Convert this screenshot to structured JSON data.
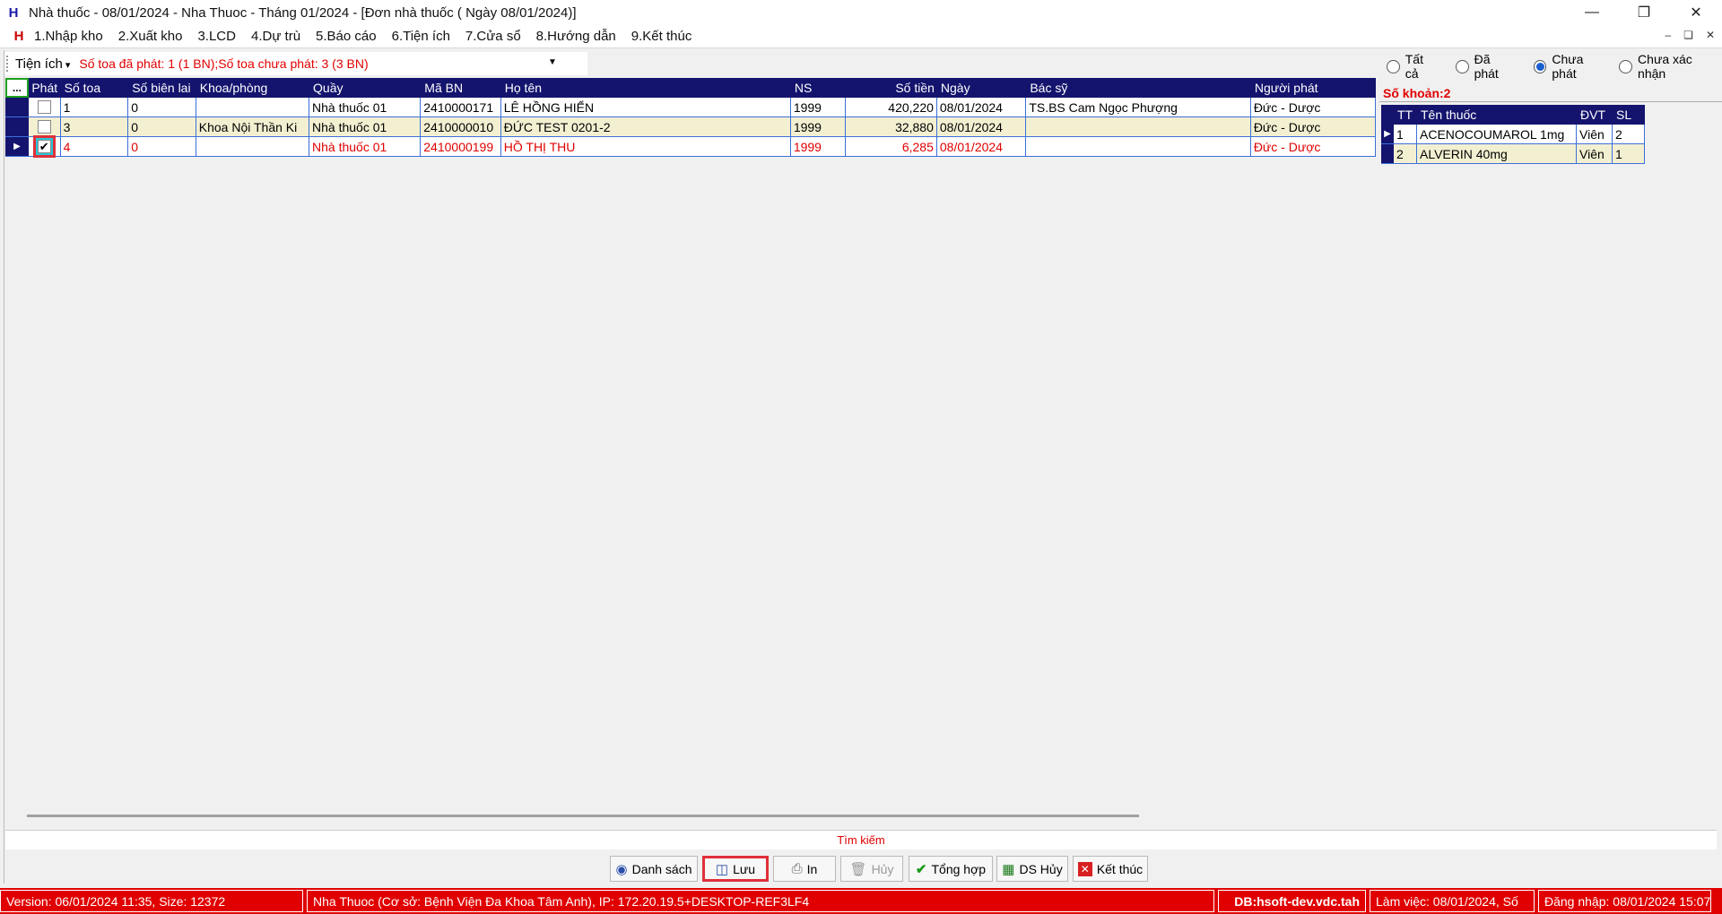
{
  "window": {
    "title": "Nhà thuốc - 08/01/2024 - Nha Thuoc - Tháng 01/2024 - [Đơn nhà thuốc ( Ngày 08/01/2024)]",
    "app_icon": "H",
    "controls": [
      "minimize-icon",
      "restore-icon",
      "close-icon"
    ]
  },
  "menu": {
    "logo": "H",
    "items": [
      "1.Nhập kho",
      "2.Xuất kho",
      "3.LCD",
      "4.Dự trù",
      "5.Báo cáo",
      "6.Tiện ích",
      "7.Cửa sổ",
      "8.Hướng dẫn",
      "9.Kết thúc"
    ]
  },
  "toolbar": {
    "tien_ich_label": "Tiện ích",
    "status_text": "Số toa đã phát: 1 (1 BN);Số toa chưa phát: 3 (3 BN)"
  },
  "grid": {
    "corner_label": "...",
    "columns": [
      "Phát",
      "Số toa",
      "Số biên lai",
      "Khoa/phòng",
      "Quầy",
      "Mã BN",
      "Họ tên",
      "NS",
      "Số tiền",
      "Ngày",
      "Bác sỹ",
      "Người phát"
    ],
    "rows": [
      {
        "phat": false,
        "so_toa": "1",
        "so_bien_lai": "0",
        "khoa": "",
        "quay": "Nhà thuốc 01",
        "ma_bn": "2410000171",
        "ho_ten": "LÊ HỒNG HIỂN",
        "ns": "1999",
        "so_tien": "420,220",
        "ngay": "08/01/2024",
        "bac_sy": "TS.BS Cam Ngọc Phượng",
        "nguoi_phat": "Đức - Dược"
      },
      {
        "phat": false,
        "so_toa": "3",
        "so_bien_lai": "0",
        "khoa": "Khoa Nội Thần Ki",
        "quay": "Nhà thuốc 01",
        "ma_bn": "2410000010",
        "ho_ten": "ĐỨC TEST 0201-2",
        "ns": "1999",
        "so_tien": "32,880",
        "ngay": "08/01/2024",
        "bac_sy": "",
        "nguoi_phat": "Đức - Dược"
      },
      {
        "phat": true,
        "so_toa": "4",
        "so_bien_lai": "0",
        "khoa": "",
        "quay": "Nhà thuốc 01",
        "ma_bn": "2410000199",
        "ho_ten": "HỒ THỊ THU",
        "ns": "1999",
        "so_tien": "6,285",
        "ngay": "08/01/2024",
        "bac_sy": "",
        "nguoi_phat": "Đức - Dược"
      }
    ]
  },
  "filter": {
    "options": [
      "Tất cả",
      "Đã phát",
      "Chưa phát",
      "Chưa xác nhận"
    ],
    "selected": "Chưa phát"
  },
  "detail": {
    "so_khoan": "Số khoản:2",
    "columns": [
      "TT",
      "Tên thuốc",
      "ĐVT",
      "SL"
    ],
    "rows": [
      {
        "tt": "1",
        "ten": "ACENOCOUMAROL 1mg",
        "dvt": "Viên",
        "sl": "2"
      },
      {
        "tt": "2",
        "ten": "ALVERIN 40mg",
        "dvt": "Viên",
        "sl": "1"
      }
    ]
  },
  "search_label": "Tìm kiếm",
  "buttons": {
    "danh_sach": "Danh sách",
    "luu": "Lưu",
    "in": "In",
    "huy": "Hủy",
    "tong_hop": "Tổng hợp",
    "ds_huy": "DS Hủy",
    "ket_thuc": "Kết thúc"
  },
  "status": {
    "version": "Version: 06/01/2024 11:35, Size: 12372",
    "site": "Nha Thuoc (Cơ sở: Bệnh Viện Đa Khoa Tâm Anh), IP: 172.20.19.5+DESKTOP-REF3LF4",
    "db": "DB:hsoft-dev.vdc.tah",
    "lam_viec": "Làm việc: 08/01/2024, Số",
    "dang_nhap": "Đăng nhập: 08/01/2024 15:07"
  },
  "colors": {
    "header_bg": "#14146e",
    "status_red": "#e00000",
    "row_alt": "#f3f0d2",
    "highlight": "#e0303a"
  }
}
